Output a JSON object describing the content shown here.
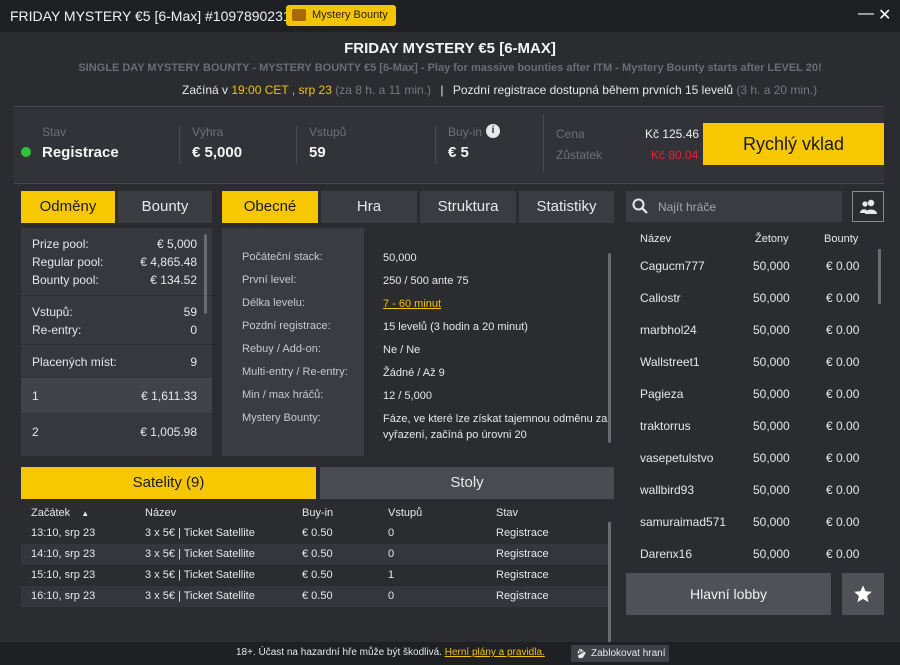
{
  "window": {
    "title": "FRIDAY MYSTERY €5 [6-Max] #1097890231",
    "badge": "Mystery Bounty",
    "minimize": "—",
    "close": "✕"
  },
  "header": {
    "title": "FRIDAY MYSTERY €5 [6-MAX]",
    "subtitle": "SINGLE DAY MYSTERY BOUNTY - MYSTERY BOUNTY €5 [6-Max] - Play for massive bounties after ITM - Mystery Bounty starts after LEVEL 20!",
    "starts_prefix": "Začíná v",
    "starts_time": "19:00 CET , srp 23",
    "starts_remaining": "(za 8 h. a 11 min.)",
    "late_reg": "Pozdní registrace dostupná během prvních 15 levelů",
    "late_reg_remaining": "(3 h. a 20 min.)"
  },
  "info": {
    "status_label": "Stav",
    "status_value": "Registrace",
    "prize_label": "Výhra",
    "prize_value": "€ 5,000",
    "entries_label": "Vstupů",
    "entries_value": "59",
    "buyin_label": "Buy-in",
    "buyin_value": "€ 5",
    "price_label": "Cena",
    "price_value": "Kč 125.46",
    "balance_label": "Zůstatek",
    "balance_value": "Kč 80.04",
    "quick_button": "Rychlý vklad"
  },
  "colors": {
    "accent": "#f7c800",
    "status_green": "#2cc63b",
    "balance_red": "#e0242b"
  },
  "prize_tabs": [
    "Odměny",
    "Bounty"
  ],
  "prize": {
    "rows": [
      {
        "label": "Prize pool:",
        "value": "€ 5,000"
      },
      {
        "label": "Regular pool:",
        "value": "€ 4,865.48"
      },
      {
        "label": "Bounty pool:",
        "value": "€ 134.52"
      },
      {
        "label": "Vstupů:",
        "value": "59"
      },
      {
        "label": "Re-entry:",
        "value": "0"
      },
      {
        "label": "Placených míst:",
        "value": "9"
      }
    ],
    "places": [
      {
        "place": "1",
        "amount": "€ 1,611.33"
      },
      {
        "place": "2",
        "amount": "€ 1,005.98"
      }
    ]
  },
  "info_tabs": [
    "Obecné",
    "Hra",
    "Struktura",
    "Statistiky"
  ],
  "general": [
    {
      "label": "Počáteční stack:",
      "value": "50,000"
    },
    {
      "label": "První level:",
      "value": "250 / 500 ante 75"
    },
    {
      "label": "Délka levelu:",
      "value": "7 - 60 minut"
    },
    {
      "label": "Pozdní registrace:",
      "value": "15 levelů (3 hodin a 20 minut)"
    },
    {
      "label": "Rebuy / Add-on:",
      "value": "Ne / Ne"
    },
    {
      "label": "Multi-entry / Re-entry:",
      "value": "Žádné / Až 9"
    },
    {
      "label": "Min / max hráčů:",
      "value": "12 / 5,000"
    },
    {
      "label": "Mystery Bounty:",
      "value": "Fáze, ve které lze získat tajemnou odměnu za vyřazení, začíná po úrovni 20"
    }
  ],
  "bottom_tabs": [
    "Satelity (9)",
    "Stoly"
  ],
  "satellites": {
    "headers": [
      "Začátek",
      "Název",
      "Buy-in",
      "Vstupů",
      "Stav"
    ],
    "sort_indicator": "▲",
    "rows": [
      [
        "13:10, srp 23",
        "3 x 5€ | Ticket Satellite",
        "€ 0.50",
        "0",
        "Registrace"
      ],
      [
        "14:10, srp 23",
        "3 x 5€ | Ticket Satellite",
        "€ 0.50",
        "0",
        "Registrace"
      ],
      [
        "15:10, srp 23",
        "3 x 5€ | Ticket Satellite",
        "€ 0.50",
        "1",
        "Registrace"
      ],
      [
        "16:10, srp 23",
        "3 x 5€ | Ticket Satellite",
        "€ 0.50",
        "0",
        "Registrace"
      ]
    ]
  },
  "players": {
    "search_placeholder": "Najít hráče",
    "headers": [
      "Název",
      "Žetony",
      "Bounty"
    ],
    "rows": [
      [
        "Cagucm777",
        "50,000",
        "€ 0.00"
      ],
      [
        "Caliostr",
        "50,000",
        "€ 0.00"
      ],
      [
        "marbhol24",
        "50,000",
        "€ 0.00"
      ],
      [
        "Wallstreet1",
        "50,000",
        "€ 0.00"
      ],
      [
        "Pagieza",
        "50,000",
        "€ 0.00"
      ],
      [
        "traktorrus",
        "50,000",
        "€ 0.00"
      ],
      [
        "vasepetulstvo",
        "50,000",
        "€ 0.00"
      ],
      [
        "wallbird93",
        "50,000",
        "€ 0.00"
      ],
      [
        "samuraimad571",
        "50,000",
        "€ 0.00"
      ],
      [
        "Darenx16",
        "50,000",
        "€ 0.00"
      ]
    ],
    "lobby_button": "Hlavní lobby"
  },
  "footer": {
    "text": "18+. Účast na hazardní hře může být škodlivá.",
    "link": "Herní plány a pravidla.",
    "block_button": "Zablokovat hraní"
  }
}
